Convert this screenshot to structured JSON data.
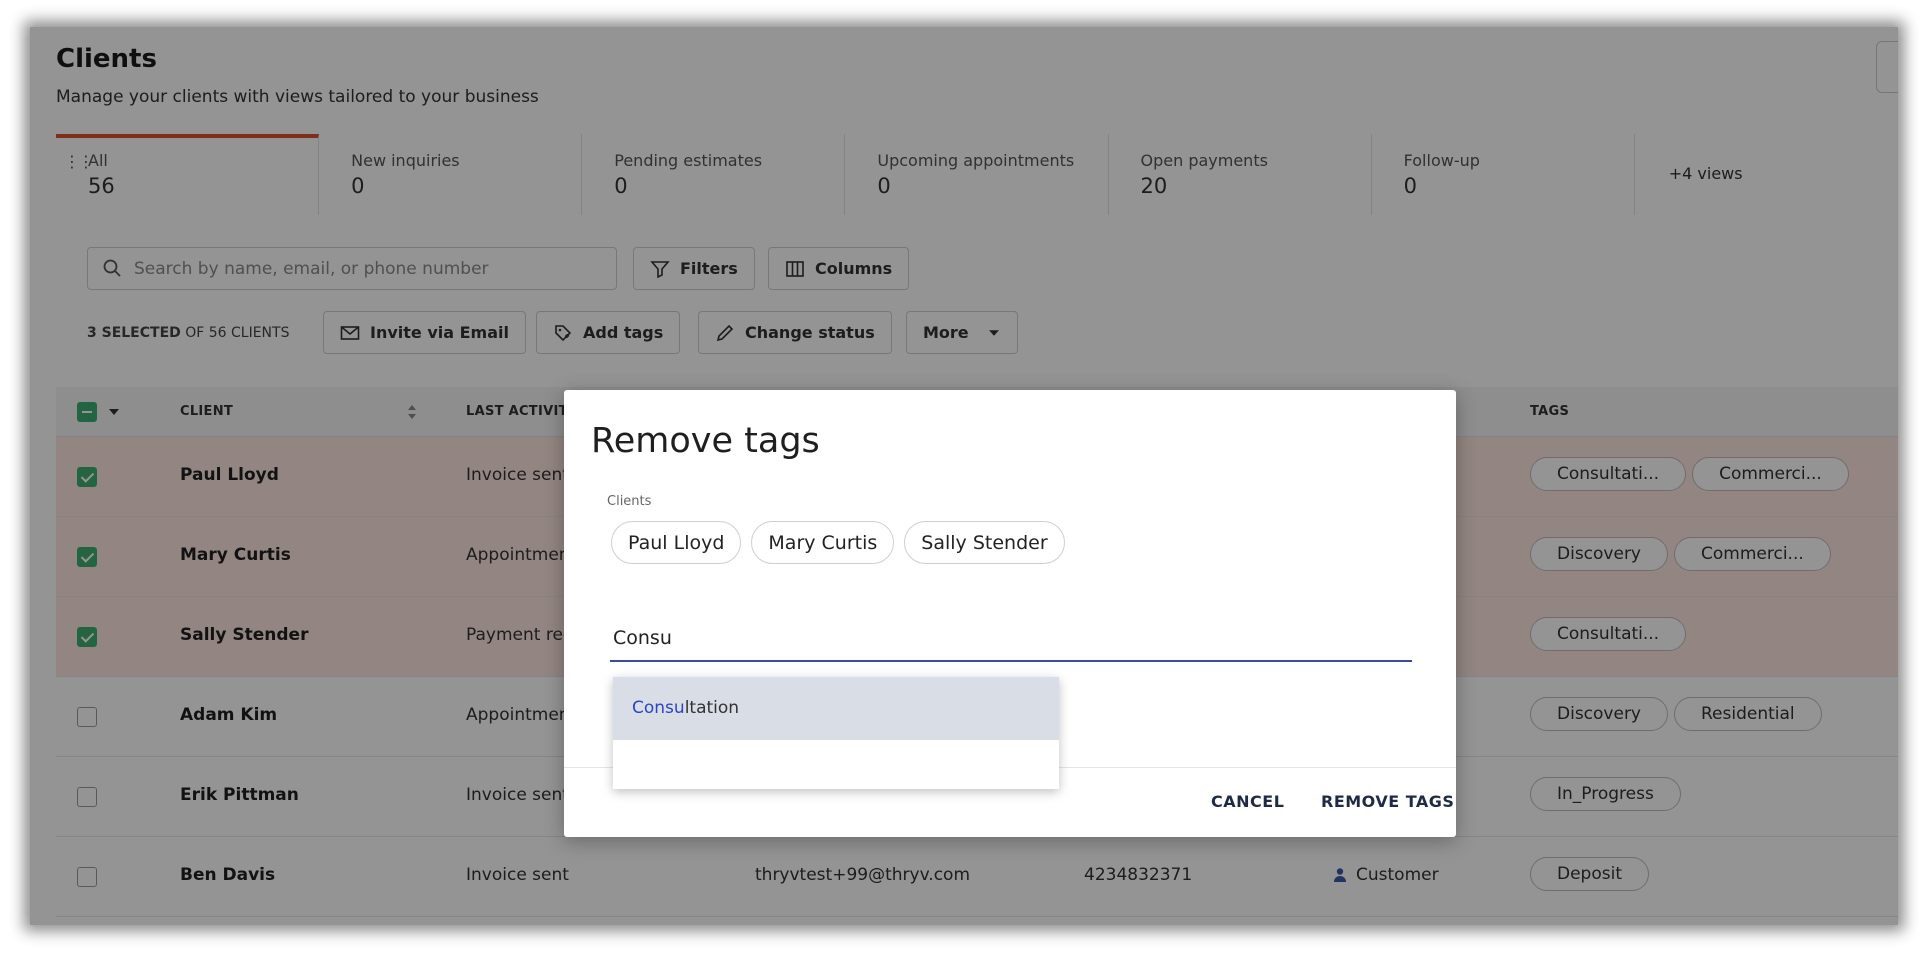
{
  "header": {
    "title": "Clients",
    "subtitle": "Manage your clients with views tailored to your business"
  },
  "tabs": [
    {
      "label": "All",
      "count": "56"
    },
    {
      "label": "New inquiries",
      "count": "0"
    },
    {
      "label": "Pending estimates",
      "count": "0"
    },
    {
      "label": "Upcoming appointments",
      "count": "0"
    },
    {
      "label": "Open payments",
      "count": "20"
    },
    {
      "label": "Follow-up",
      "count": "0"
    }
  ],
  "more_views": "+4 views",
  "search": {
    "placeholder": "Search by name, email, or phone number"
  },
  "toolbar": {
    "filters": "Filters",
    "columns": "Columns",
    "selected_count": "3 SELECTED",
    "selected_of": "OF 56 CLIENTS",
    "invite": "Invite via Email",
    "add_tags": "Add tags",
    "change_status": "Change status",
    "more": "More"
  },
  "table": {
    "headers": {
      "client": "CLIENT",
      "last_activity": "LAST ACTIVITY",
      "tags": "TAGS"
    },
    "rows": [
      {
        "name": "Paul Lloyd",
        "activity": "Invoice sent",
        "email": "",
        "phone": "",
        "status": "",
        "tags": [
          "Consultati...",
          "Commerci..."
        ],
        "checked": true
      },
      {
        "name": "Mary Curtis",
        "activity": "Appointment",
        "email": "",
        "phone": "",
        "status": "",
        "tags": [
          "Discovery",
          "Commerci..."
        ],
        "checked": true
      },
      {
        "name": "Sally Stender",
        "activity": "Payment rece",
        "email": "",
        "phone": "",
        "status": "",
        "tags": [
          "Consultati..."
        ],
        "checked": true
      },
      {
        "name": "Adam Kim",
        "activity": "Appointment",
        "email": "",
        "phone": "",
        "status": "",
        "tags": [
          "Discovery",
          "Residential"
        ],
        "checked": false
      },
      {
        "name": "Erik Pittman",
        "activity": "Invoice sent",
        "email": "",
        "phone": "",
        "status": "",
        "tags": [
          "In_Progress"
        ],
        "checked": false
      },
      {
        "name": "Ben Davis",
        "activity": "Invoice sent",
        "email": "thryvtest+99@thryv.com",
        "phone": "4234832371",
        "status": "Customer",
        "tags": [
          "Deposit"
        ],
        "checked": false
      }
    ]
  },
  "modal": {
    "title": "Remove tags",
    "clients_label": "Clients",
    "clients": [
      "Paul Lloyd",
      "Mary Curtis",
      "Sally Stender"
    ],
    "input_value": "Consu",
    "suggestion_match": "Consu",
    "suggestion_rest": "ltation",
    "cancel": "CANCEL",
    "confirm": "REMOVE TAGS"
  },
  "colors": {
    "accent": "#d9512c",
    "checkbox": "#3fae70",
    "input_underline": "#3a4aa0",
    "selected_row": "#fde7e1"
  }
}
